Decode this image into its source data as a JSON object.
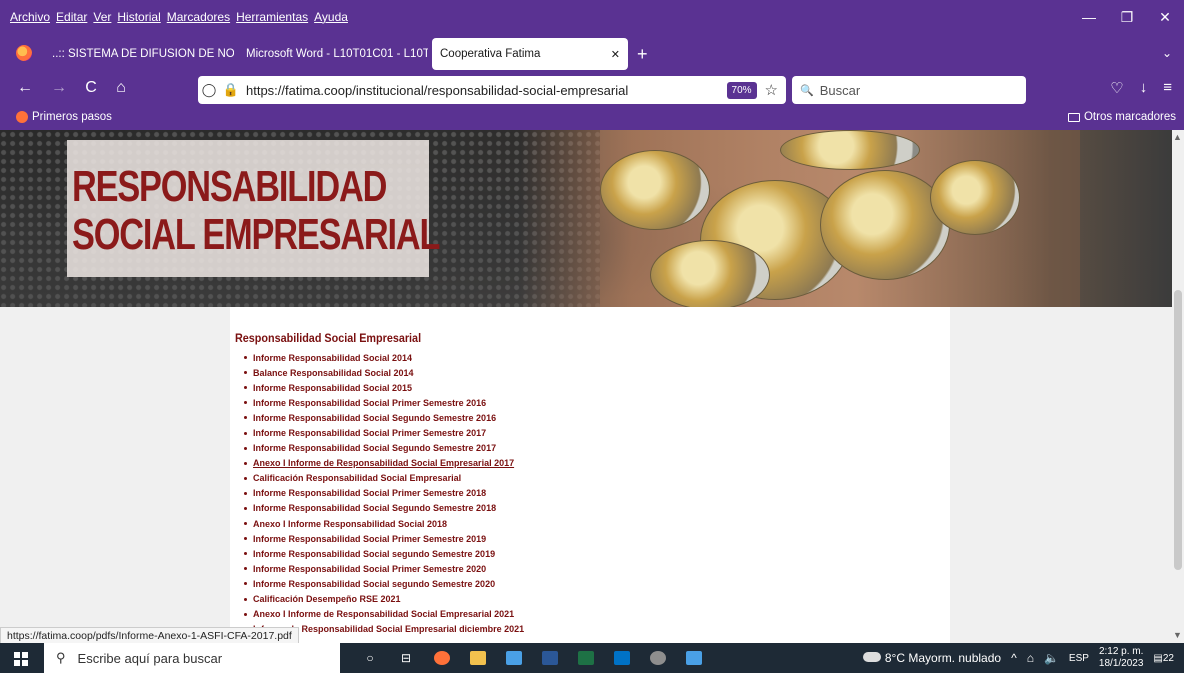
{
  "menubar": {
    "items": [
      "Archivo",
      "Editar",
      "Ver",
      "Historial",
      "Marcadores",
      "Herramientas",
      "Ayuda"
    ]
  },
  "window_controls": {
    "minimize": "—",
    "restore": "❐",
    "close": "✕"
  },
  "tabs": [
    {
      "label": "..:: SISTEMA DE DIFUSION DE NORM",
      "close": "✕"
    },
    {
      "label": "Microsoft Word - L10T01C01 - L10T",
      "close": "✕"
    },
    {
      "label": "Cooperativa Fatima",
      "close": "✕"
    }
  ],
  "newtab": "+",
  "tablist": "⌄",
  "nav": {
    "back": "←",
    "forward": "→",
    "reload": "C",
    "home": "⌂",
    "url": "https://fatima.coop/institucional/responsabilidad-social-empresarial",
    "zoom": "70%",
    "star": "☆",
    "search_placeholder": "Buscar",
    "search_icon": "🔍",
    "pocket": "♡",
    "download": "↓",
    "menu": "≡"
  },
  "bookmarks": {
    "first": "Primeros pasos",
    "other": "Otros marcadores"
  },
  "banner": {
    "line1": "RESPONSABILIDAD",
    "line2": "SOCIAL EMPRESARIAL"
  },
  "content": {
    "title": "Responsabilidad Social Empresarial",
    "items": [
      "Informe Responsabilidad Social 2014",
      "Balance Responsabilidad Social 2014",
      "Informe Responsabilidad Social 2015",
      "Informe Responsabilidad Social Primer Semestre 2016",
      "Informe Responsabilidad Social Segundo Semestre 2016",
      "Informe Responsabilidad Social Primer Semestre 2017",
      "Informe Responsabilidad Social Segundo Semestre 2017",
      "Anexo I Informe de Responsabilidad Social Empresarial 2017",
      "Calificación Responsabilidad Social Empresarial",
      "Informe Responsabilidad Social Primer Semestre 2018",
      "Informe Responsabilidad Social Segundo Semestre 2018",
      "Anexo I Informe Responsabilidad Social 2018",
      "Informe Responsabilidad Social Primer Semestre 2019",
      "Informe Responsabilidad Social segundo Semestre 2019",
      "Informe Responsabilidad Social Primer Semestre 2020",
      "Informe Responsabilidad Social segundo Semestre 2020",
      "Calificación Desempeño RSE 2021",
      "Anexo I Informe de Responsabilidad Social Empresarial 2021",
      "Informe de Responsabilidad Social Empresarial diciembre 2021"
    ]
  },
  "status_url": "https://fatima.coop/pdfs/Informe-Anexo-1-ASFI-CFA-2017.pdf",
  "taskbar": {
    "search_text": "Escribe aquí para buscar",
    "weather": "8°C  Mayorm. nublado",
    "lang": "ESP",
    "time": "2:12 p. m.",
    "date": "18/1/2023",
    "notifications": "22"
  },
  "colors": {
    "chrome": "#5a3292",
    "link": "#7a1010",
    "taskbar": "#1e2a36"
  }
}
